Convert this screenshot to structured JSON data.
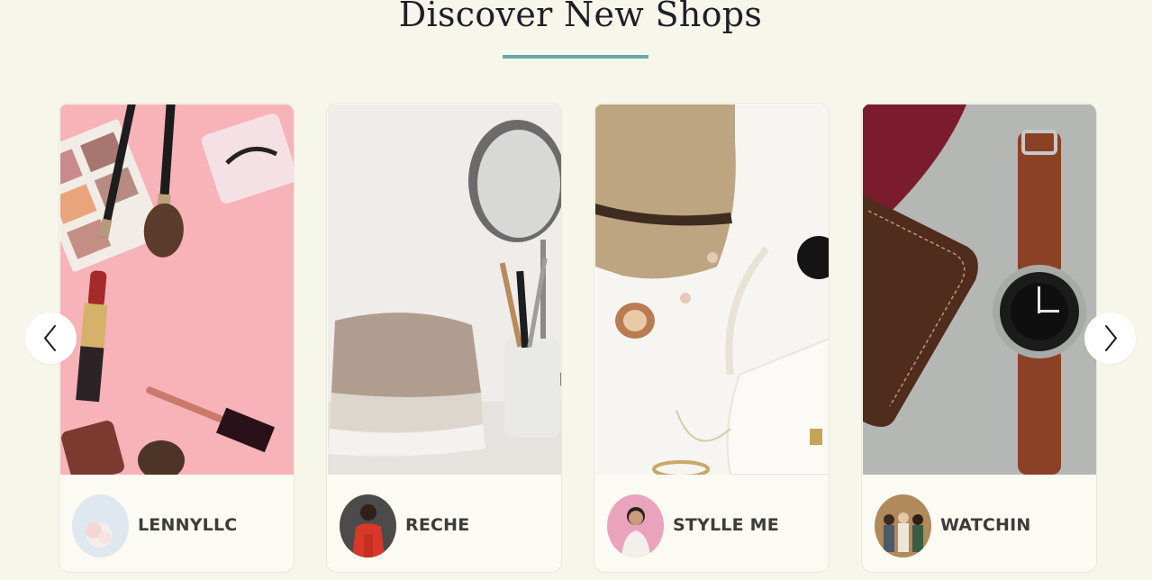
{
  "section": {
    "title": "Discover New Shops",
    "accent_color": "#6aa7a8"
  },
  "carousel": {
    "prev_icon": "chevron-left-icon",
    "next_icon": "chevron-right-icon",
    "shops": [
      {
        "name": "LENNYLLC",
        "image": "makeup-flatlay-photo",
        "avatar": "shop-avatar-flower"
      },
      {
        "name": "RECHE",
        "image": "towels-and-brushes-photo",
        "avatar": "shop-avatar-person-red"
      },
      {
        "name": "STYLLE ME",
        "image": "hat-and-accessories-photo",
        "avatar": "shop-avatar-woman"
      },
      {
        "name": "WATCHIN",
        "image": "watch-and-wallet-photo",
        "avatar": "shop-avatar-group"
      }
    ]
  }
}
